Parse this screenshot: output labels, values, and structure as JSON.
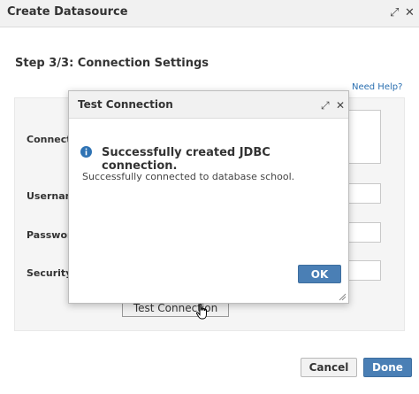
{
  "window": {
    "title": "Create Datasource",
    "maximize_icon": "expand-icon",
    "close_icon": "close-icon"
  },
  "wizard": {
    "step_title": "Step 3/3: Connection Settings",
    "help_link": "Need Help?",
    "fields": [
      {
        "label": "Connect",
        "value": ""
      },
      {
        "label": "Usernam",
        "value": ""
      },
      {
        "label": "Passwor",
        "value": ""
      },
      {
        "label": "Security",
        "value": ""
      }
    ],
    "test_button": "Test Connection"
  },
  "footer": {
    "cancel_label": "Cancel",
    "done_label": "Done"
  },
  "modal": {
    "title": "Test Connection",
    "heading": "Successfully created JDBC connection.",
    "detail": "Successfully connected to database school.",
    "ok_label": "OK",
    "info_icon": "info-icon"
  },
  "colors": {
    "accent": "#4a7fb5",
    "info_icon": "#2f73b4",
    "link": "#2a6fb0"
  }
}
